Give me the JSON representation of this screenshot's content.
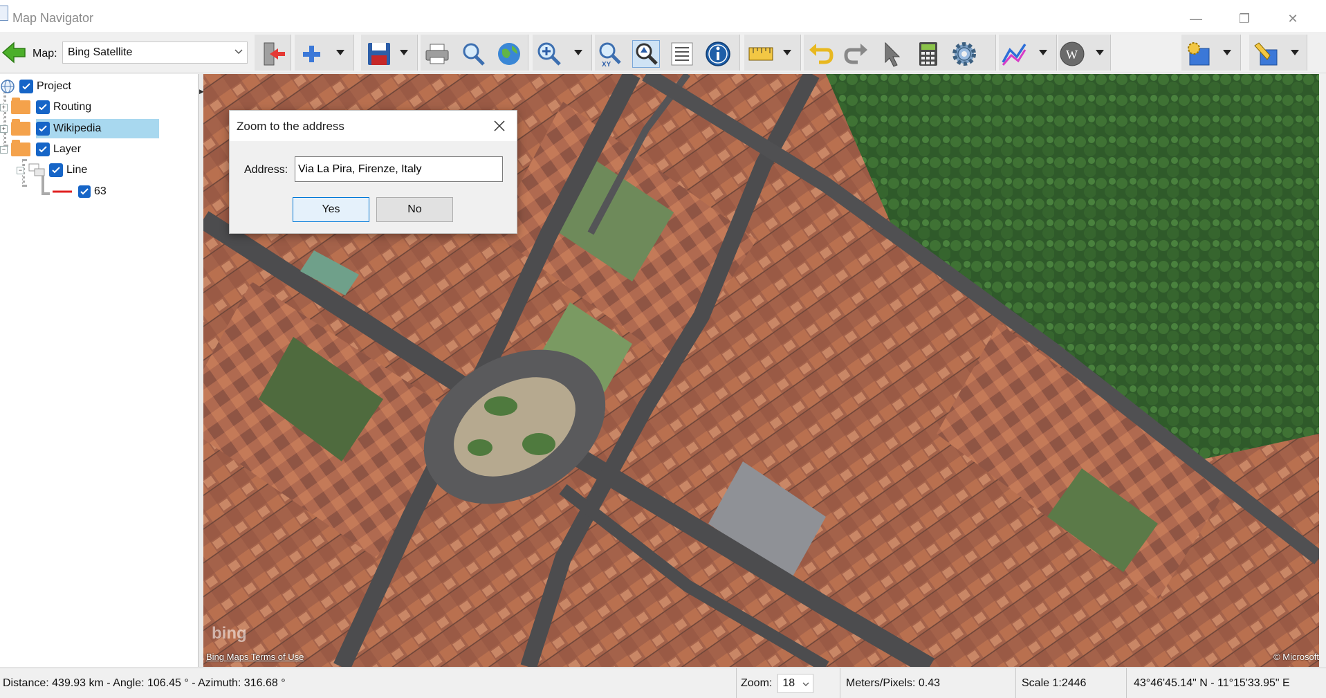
{
  "window": {
    "title": "Map Navigator",
    "minimize_glyph": "—",
    "restore_glyph": "❐",
    "close_glyph": "✕"
  },
  "toolbar": {
    "map_label": "Map:",
    "map_value": "Bing Satellite",
    "icons": [
      "back-arrow-icon",
      "exit-icon",
      "add-icon",
      "save-icon",
      "print-icon",
      "search-icon",
      "globe-icon",
      "zoom-icon",
      "zoom-xy-icon",
      "zoom-extent-icon",
      "list-icon",
      "info-icon",
      "measure-icon",
      "undo-icon",
      "redo-icon",
      "pointer-icon",
      "calculator-icon",
      "settings-icon",
      "draw-line-icon",
      "wikipedia-icon",
      "layer-style-icon",
      "edit-icon"
    ]
  },
  "layer_tree": {
    "root": "Project",
    "items": [
      {
        "label": "Routing",
        "checked": true,
        "expanded": false
      },
      {
        "label": "Wikipedia",
        "checked": true,
        "expanded": false,
        "selected": true
      },
      {
        "label": "Layer",
        "checked": true,
        "expanded": true
      },
      {
        "label": "Line",
        "checked": true
      },
      {
        "label": "63",
        "checked": true,
        "line_color": "#e02020"
      }
    ]
  },
  "map": {
    "logo": "bing",
    "terms_link": "Bing Maps Terms of Use",
    "credit": "© Microsoft"
  },
  "dialog": {
    "title": "Zoom to the address",
    "address_label": "Address:",
    "address_value": "Via La Pira, Firenze, Italy",
    "yes_label": "Yes",
    "no_label": "No"
  },
  "status": {
    "distance": "Distance: 439.93 km - Angle: 106.45 ° - Azimuth: 316.68 °",
    "zoom_label": "Zoom:",
    "zoom_value": "18",
    "meters_per_pixel": "Meters/Pixels:   0.43",
    "scale": "Scale 1:2446",
    "coordinates": "43°46'45.14\" N - 11°15'33.95\" E"
  },
  "colors": {
    "accent": "#1665c7",
    "selection": "#a8d8ef",
    "folder": "#f4a24b"
  }
}
